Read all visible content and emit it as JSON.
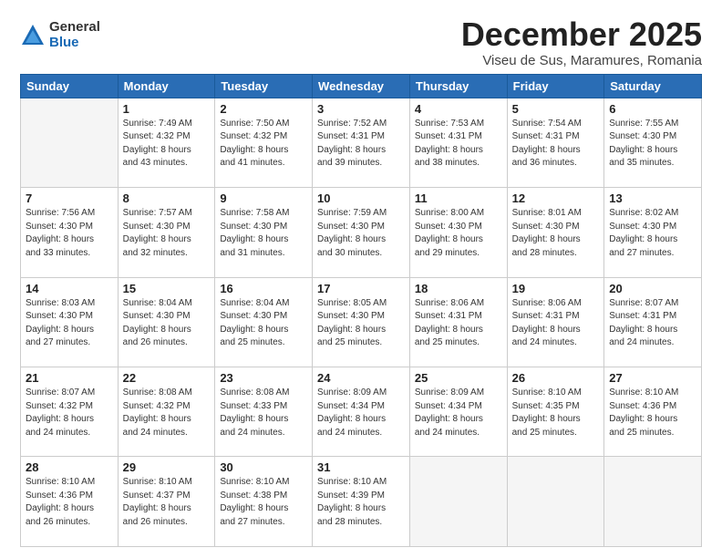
{
  "header": {
    "logo_general": "General",
    "logo_blue": "Blue",
    "month_title": "December 2025",
    "subtitle": "Viseu de Sus, Maramures, Romania"
  },
  "days_of_week": [
    "Sunday",
    "Monday",
    "Tuesday",
    "Wednesday",
    "Thursday",
    "Friday",
    "Saturday"
  ],
  "weeks": [
    [
      {
        "day": "",
        "info": ""
      },
      {
        "day": "1",
        "info": "Sunrise: 7:49 AM\nSunset: 4:32 PM\nDaylight: 8 hours\nand 43 minutes."
      },
      {
        "day": "2",
        "info": "Sunrise: 7:50 AM\nSunset: 4:32 PM\nDaylight: 8 hours\nand 41 minutes."
      },
      {
        "day": "3",
        "info": "Sunrise: 7:52 AM\nSunset: 4:31 PM\nDaylight: 8 hours\nand 39 minutes."
      },
      {
        "day": "4",
        "info": "Sunrise: 7:53 AM\nSunset: 4:31 PM\nDaylight: 8 hours\nand 38 minutes."
      },
      {
        "day": "5",
        "info": "Sunrise: 7:54 AM\nSunset: 4:31 PM\nDaylight: 8 hours\nand 36 minutes."
      },
      {
        "day": "6",
        "info": "Sunrise: 7:55 AM\nSunset: 4:30 PM\nDaylight: 8 hours\nand 35 minutes."
      }
    ],
    [
      {
        "day": "7",
        "info": "Sunrise: 7:56 AM\nSunset: 4:30 PM\nDaylight: 8 hours\nand 33 minutes."
      },
      {
        "day": "8",
        "info": "Sunrise: 7:57 AM\nSunset: 4:30 PM\nDaylight: 8 hours\nand 32 minutes."
      },
      {
        "day": "9",
        "info": "Sunrise: 7:58 AM\nSunset: 4:30 PM\nDaylight: 8 hours\nand 31 minutes."
      },
      {
        "day": "10",
        "info": "Sunrise: 7:59 AM\nSunset: 4:30 PM\nDaylight: 8 hours\nand 30 minutes."
      },
      {
        "day": "11",
        "info": "Sunrise: 8:00 AM\nSunset: 4:30 PM\nDaylight: 8 hours\nand 29 minutes."
      },
      {
        "day": "12",
        "info": "Sunrise: 8:01 AM\nSunset: 4:30 PM\nDaylight: 8 hours\nand 28 minutes."
      },
      {
        "day": "13",
        "info": "Sunrise: 8:02 AM\nSunset: 4:30 PM\nDaylight: 8 hours\nand 27 minutes."
      }
    ],
    [
      {
        "day": "14",
        "info": "Sunrise: 8:03 AM\nSunset: 4:30 PM\nDaylight: 8 hours\nand 27 minutes."
      },
      {
        "day": "15",
        "info": "Sunrise: 8:04 AM\nSunset: 4:30 PM\nDaylight: 8 hours\nand 26 minutes."
      },
      {
        "day": "16",
        "info": "Sunrise: 8:04 AM\nSunset: 4:30 PM\nDaylight: 8 hours\nand 25 minutes."
      },
      {
        "day": "17",
        "info": "Sunrise: 8:05 AM\nSunset: 4:30 PM\nDaylight: 8 hours\nand 25 minutes."
      },
      {
        "day": "18",
        "info": "Sunrise: 8:06 AM\nSunset: 4:31 PM\nDaylight: 8 hours\nand 25 minutes."
      },
      {
        "day": "19",
        "info": "Sunrise: 8:06 AM\nSunset: 4:31 PM\nDaylight: 8 hours\nand 24 minutes."
      },
      {
        "day": "20",
        "info": "Sunrise: 8:07 AM\nSunset: 4:31 PM\nDaylight: 8 hours\nand 24 minutes."
      }
    ],
    [
      {
        "day": "21",
        "info": "Sunrise: 8:07 AM\nSunset: 4:32 PM\nDaylight: 8 hours\nand 24 minutes."
      },
      {
        "day": "22",
        "info": "Sunrise: 8:08 AM\nSunset: 4:32 PM\nDaylight: 8 hours\nand 24 minutes."
      },
      {
        "day": "23",
        "info": "Sunrise: 8:08 AM\nSunset: 4:33 PM\nDaylight: 8 hours\nand 24 minutes."
      },
      {
        "day": "24",
        "info": "Sunrise: 8:09 AM\nSunset: 4:34 PM\nDaylight: 8 hours\nand 24 minutes."
      },
      {
        "day": "25",
        "info": "Sunrise: 8:09 AM\nSunset: 4:34 PM\nDaylight: 8 hours\nand 24 minutes."
      },
      {
        "day": "26",
        "info": "Sunrise: 8:10 AM\nSunset: 4:35 PM\nDaylight: 8 hours\nand 25 minutes."
      },
      {
        "day": "27",
        "info": "Sunrise: 8:10 AM\nSunset: 4:36 PM\nDaylight: 8 hours\nand 25 minutes."
      }
    ],
    [
      {
        "day": "28",
        "info": "Sunrise: 8:10 AM\nSunset: 4:36 PM\nDaylight: 8 hours\nand 26 minutes."
      },
      {
        "day": "29",
        "info": "Sunrise: 8:10 AM\nSunset: 4:37 PM\nDaylight: 8 hours\nand 26 minutes."
      },
      {
        "day": "30",
        "info": "Sunrise: 8:10 AM\nSunset: 4:38 PM\nDaylight: 8 hours\nand 27 minutes."
      },
      {
        "day": "31",
        "info": "Sunrise: 8:10 AM\nSunset: 4:39 PM\nDaylight: 8 hours\nand 28 minutes."
      },
      {
        "day": "",
        "info": ""
      },
      {
        "day": "",
        "info": ""
      },
      {
        "day": "",
        "info": ""
      }
    ]
  ]
}
